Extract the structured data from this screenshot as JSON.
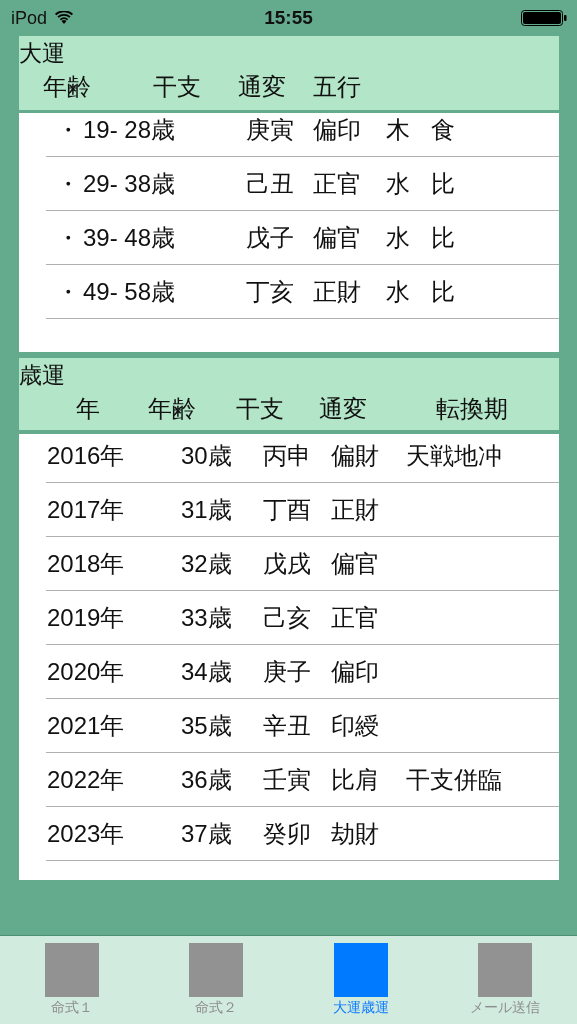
{
  "status_bar": {
    "carrier": "iPod",
    "time": "15:55"
  },
  "daiun": {
    "title": "大運",
    "columns": [
      "年齢",
      "干支",
      "通変",
      "五行"
    ],
    "rows": [
      {
        "bullet": "・",
        "age": "19- 28歳",
        "kanshi": "庚寅",
        "tsuhen": "偏印",
        "gogyo": "木",
        "column_5": "食"
      },
      {
        "bullet": "・",
        "age": "29- 38歳",
        "kanshi": "己丑",
        "tsuhen": "正官",
        "gogyo": "水",
        "column_5": "比"
      },
      {
        "bullet": "・",
        "age": "39- 48歳",
        "kanshi": "戊子",
        "tsuhen": "偏官",
        "gogyo": "水",
        "column_5": "比"
      },
      {
        "bullet": "・",
        "age": "49- 58歳",
        "kanshi": "丁亥",
        "tsuhen": "正財",
        "gogyo": "水",
        "column_5": "比"
      }
    ]
  },
  "saiun": {
    "title": "歳運",
    "columns": [
      "年",
      "年齢",
      "干支",
      "通変",
      "転換期"
    ],
    "rows": [
      {
        "year": "2016年",
        "age": "30歳",
        "kanshi": "丙申",
        "tsuhen": "偏財",
        "tenkanki": "天戦地冲"
      },
      {
        "year": "2017年",
        "age": "31歳",
        "kanshi": "丁酉",
        "tsuhen": "正財"
      },
      {
        "year": "2018年",
        "age": "32歳",
        "kanshi": "戊戌",
        "tsuhen": "偏官"
      },
      {
        "year": "2019年",
        "age": "33歳",
        "kanshi": "己亥",
        "tsuhen": "正官"
      },
      {
        "year": "2020年",
        "age": "34歳",
        "kanshi": "庚子",
        "tsuhen": "偏印"
      },
      {
        "year": "2021年",
        "age": "35歳",
        "kanshi": "辛丑",
        "tsuhen": "印綬"
      },
      {
        "year": "2022年",
        "age": "36歳",
        "kanshi": "壬寅",
        "tsuhen": "比肩",
        "tenkanki": "干支併臨"
      },
      {
        "year": "2023年",
        "age": "37歳",
        "kanshi": "癸卯",
        "tsuhen": "劫財"
      }
    ]
  },
  "tab_bar": [
    {
      "label": "命式１",
      "selected": false
    },
    {
      "label": "命式２",
      "selected": false
    },
    {
      "label": "大運歳運",
      "selected": true
    },
    {
      "label": "メール送信",
      "selected": false
    }
  ]
}
